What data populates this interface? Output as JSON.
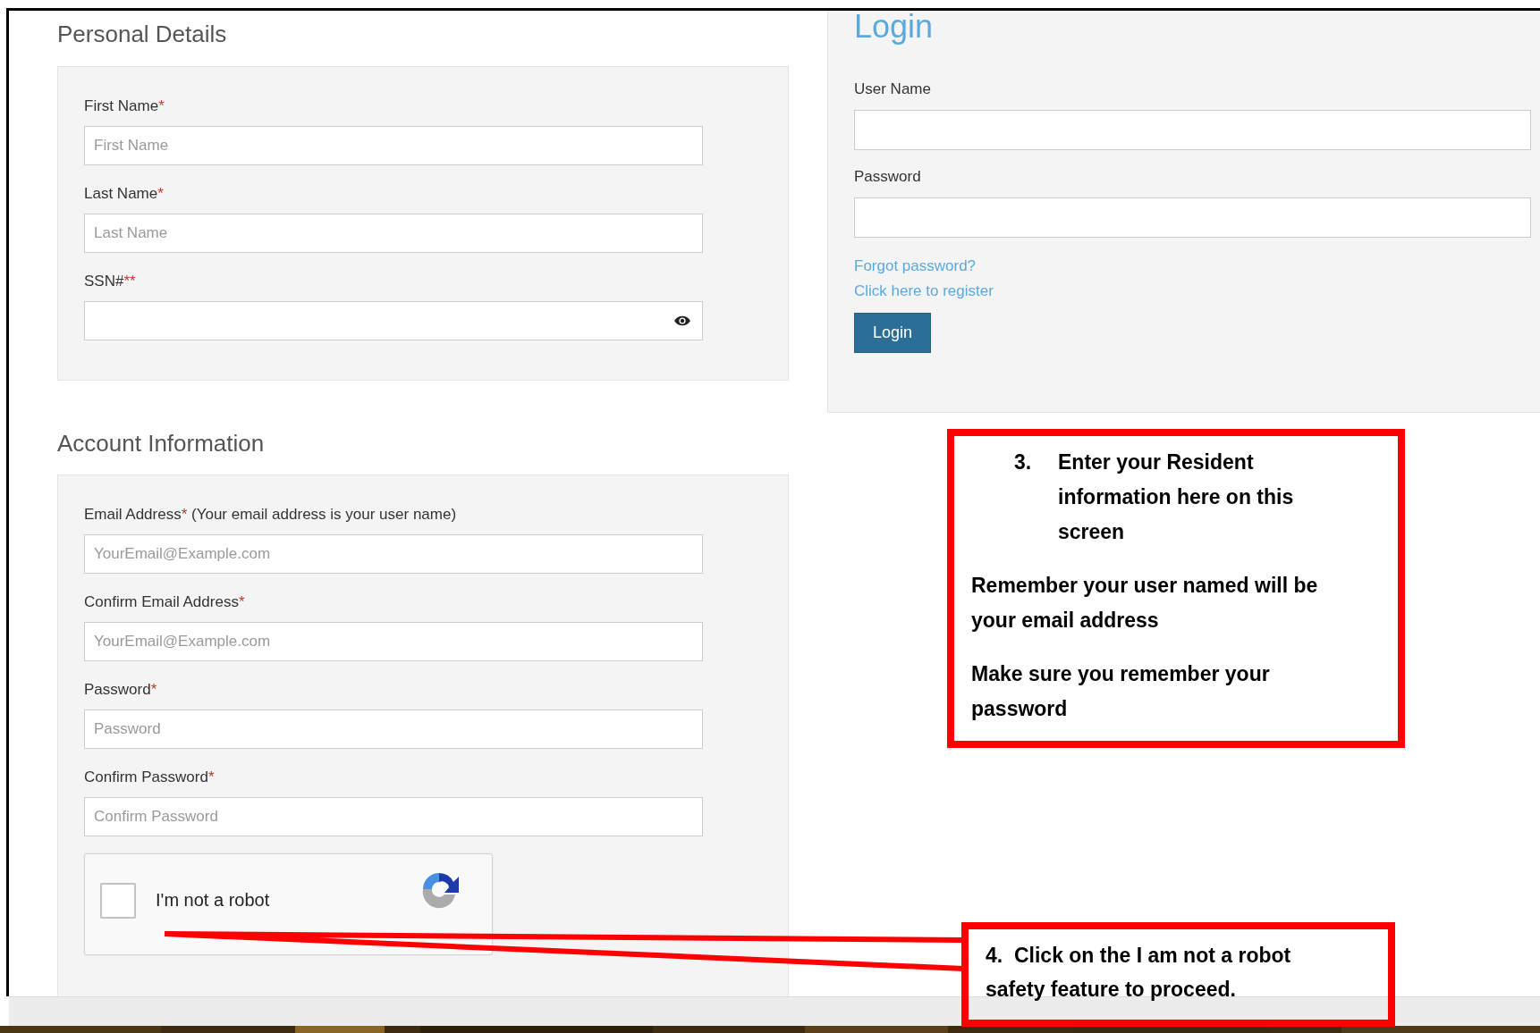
{
  "personal_details": {
    "title": "Personal Details",
    "fields": [
      {
        "kind": "text",
        "label": "First Name",
        "required_mark": "*",
        "placeholder": "First Name"
      },
      {
        "kind": "text",
        "label": "Last Name",
        "required_mark": "*",
        "placeholder": "Last Name"
      },
      {
        "kind": "secret",
        "label": "SSN#",
        "required_mark": "**"
      }
    ]
  },
  "account_information": {
    "title": "Account Information",
    "fields": [
      {
        "kind": "text",
        "label": "Email Address",
        "required_mark": "*",
        "note": " (Your email address is your user name)",
        "placeholder": "YourEmail@Example.com"
      },
      {
        "kind": "text",
        "label": "Confirm Email Address",
        "required_mark": "*",
        "placeholder": "YourEmail@Example.com"
      },
      {
        "kind": "text",
        "label": "Password",
        "required_mark": "*",
        "placeholder": "Password"
      },
      {
        "kind": "text",
        "label": "Confirm Password",
        "required_mark": "*",
        "placeholder": "Confirm Password"
      }
    ],
    "recaptcha": {
      "label": "I'm not a robot",
      "checked": false
    }
  },
  "login": {
    "title": "Login",
    "fields": [
      {
        "label": "User Name"
      },
      {
        "label": "Password"
      }
    ],
    "links": [
      "Forgot password?",
      "Click here to register"
    ],
    "button": "Login"
  },
  "callouts": [
    {
      "number": "3.",
      "text": "Enter your Resident information here on this screen",
      "notes": [
        "Remember your user named will be your email address",
        "Make sure you remember your password"
      ]
    },
    {
      "text": "4.  Click on the I am not a robot safety feature to proceed."
    }
  ]
}
